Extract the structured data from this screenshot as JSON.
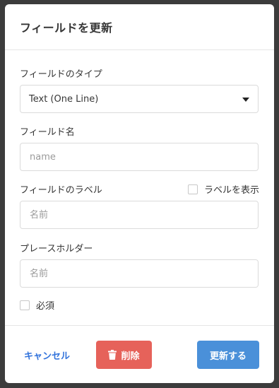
{
  "modal": {
    "title": "フィールドを更新"
  },
  "field_type": {
    "label": "フィールドのタイプ",
    "selected": "Text (One Line)"
  },
  "field_name": {
    "label": "フィールド名",
    "placeholder": "name",
    "value": ""
  },
  "field_label": {
    "label": "フィールドのラベル",
    "placeholder": "名前",
    "value": "",
    "show_label_checkbox": {
      "label": "ラベルを表示",
      "checked": false
    }
  },
  "placeholder_field": {
    "label": "プレースホルダー",
    "placeholder": "名前",
    "value": ""
  },
  "required_checkbox": {
    "label": "必須",
    "checked": false
  },
  "footer": {
    "cancel_label": "キャンセル",
    "delete_label": "削除",
    "update_label": "更新する"
  },
  "colors": {
    "link": "#3273dc",
    "danger": "#e6625a",
    "primary": "#4a90d9"
  },
  "icons": {
    "delete": "trash-icon",
    "select": "caret-down-icon"
  }
}
